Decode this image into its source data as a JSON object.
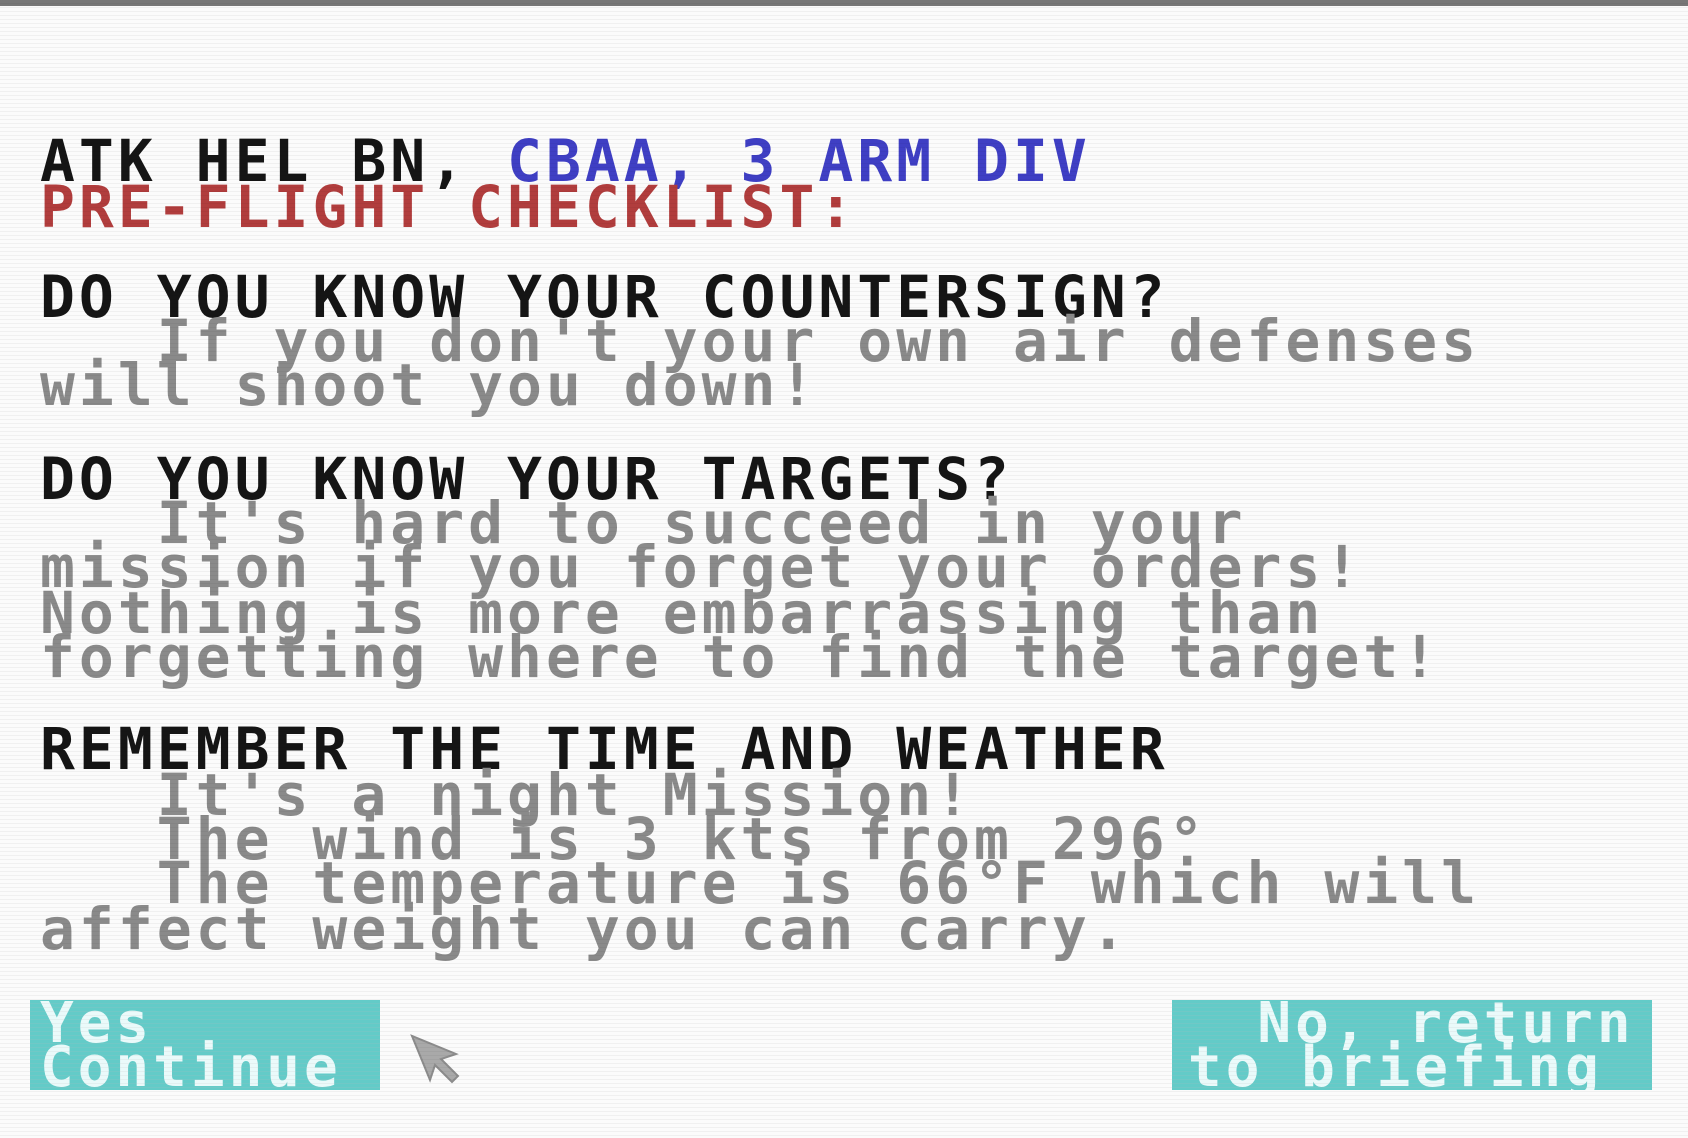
{
  "screen": {
    "title": {
      "unit_black": "ATK HEL BN, ",
      "unit_blue": "CBAA, 3 ARM DIV",
      "subtitle": "PRE-FLIGHT CHECKLIST:"
    },
    "sections": [
      {
        "heading": "DO YOU KNOW YOUR COUNTERSIGN?",
        "lines": [
          "   If you don't your own air defenses",
          "will shoot you down!"
        ]
      },
      {
        "heading": "DO YOU KNOW YOUR TARGETS?",
        "lines": [
          "   It's hard to succeed in your",
          "mission if you forget your orders!",
          "Nothing is more embarrassing than",
          "forgetting where to find the target!"
        ]
      },
      {
        "heading": "REMEMBER THE TIME AND WEATHER",
        "lines": [
          "   It's a night Mission!",
          "   The wind is 3 kts from 296°",
          "   The temperature is 66°F which will",
          "affect weight you can carry."
        ]
      }
    ],
    "buttons": {
      "yes": {
        "line1": "Yes",
        "line2": "Continue"
      },
      "no": {
        "line1": "  No, return",
        "line2": "to briefing"
      }
    },
    "colors": {
      "background": "#fbfbfb",
      "heading": "#151515",
      "unit_blue": "#3f3fc4",
      "subtitle_red": "#b13d3d",
      "body_gray": "#8a8a8a",
      "button_cyan": "#63cbc8"
    },
    "icons": {
      "pointer": "arrow-cursor-icon"
    }
  }
}
